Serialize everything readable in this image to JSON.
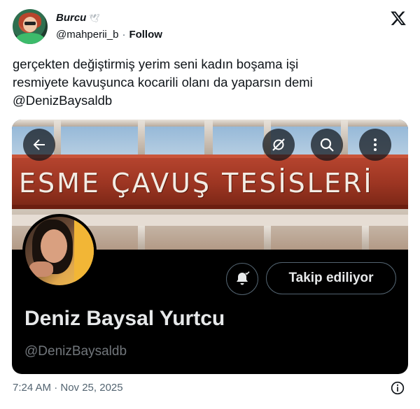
{
  "author": {
    "display_name": "Burcu",
    "handle": "@mahperii_b",
    "separator": "·",
    "follow_label": "Follow"
  },
  "tweet": {
    "lines": [
      "gerçekten değiştirmiş yerim seni kadın boşama işi",
      "resmiyete kavuşunca kocarili olanı da yaparsın demi",
      "@DenizBaysaldb"
    ]
  },
  "media": {
    "banner_sign_text": "ESME ÇAVUŞ TESİSLERİ",
    "follow_state_label": "Takip ediliyor",
    "profile_name": "Deniz Baysal Yurtcu",
    "profile_handle": "@DenizBaysaldb",
    "icons": [
      "back-arrow-icon",
      "no-gps-icon",
      "search-icon",
      "more-icon",
      "bell-check-icon"
    ]
  },
  "footer": {
    "timestamp": "7:24 AM · Nov 25, 2025"
  },
  "colors": {
    "text": "#0f1419",
    "muted": "#536471",
    "sign_red": "#a83a25",
    "card_bg": "#000000"
  }
}
